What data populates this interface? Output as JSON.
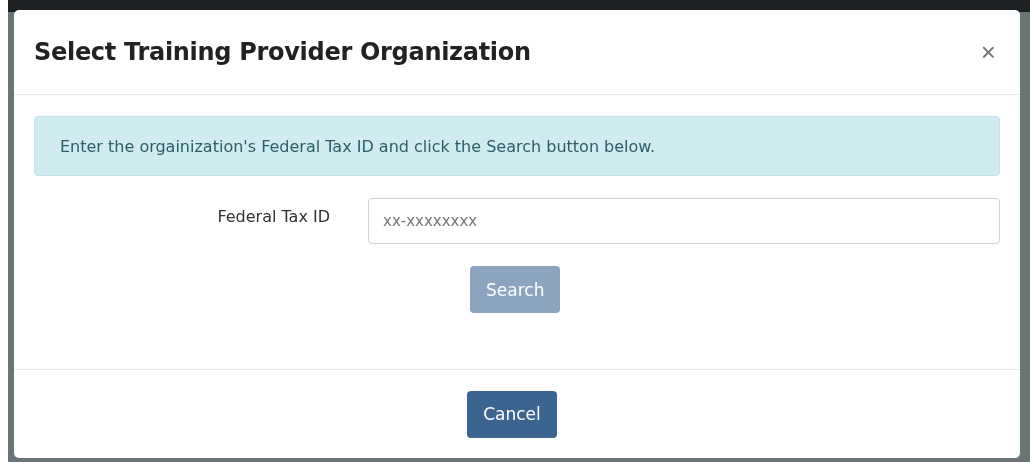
{
  "dialog": {
    "title": "Select Training Provider Organization",
    "close": "×"
  },
  "alert": "Enter the orgainization's Federal Tax ID and click the Search button below.",
  "field": {
    "label": "Federal Tax ID",
    "placeholder": "xx-xxxxxxxx"
  },
  "search_button": {
    "label": "Search",
    "disabled": true
  },
  "footer_buttons": [
    "Cancel"
  ]
}
